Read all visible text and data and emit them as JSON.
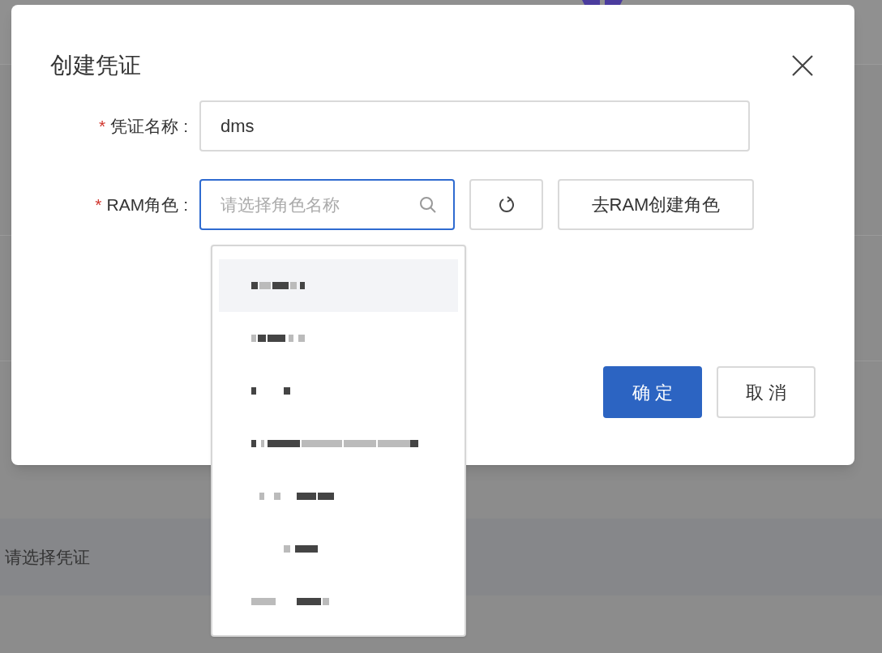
{
  "background": {
    "field_placeholder": "请选择凭证"
  },
  "dialog": {
    "title": "创建凭证",
    "fields": [
      {
        "kind": "text",
        "required_mark": "*",
        "label": "凭证名称",
        "label_suffix": ":",
        "value": "dms"
      },
      {
        "kind": "select",
        "required_mark": "*",
        "label": "RAM角色",
        "label_suffix": ":",
        "placeholder": "请选择角色名称",
        "focused": true
      }
    ],
    "role_buttons": [
      "去RAM创建角色"
    ],
    "buttons": [
      {
        "label": "确 定",
        "primary": true
      },
      {
        "label": "取 消",
        "primary": false
      }
    ]
  },
  "dropdown": {
    "options": [
      {
        "kind": "redacted",
        "highlighted": true
      },
      {
        "kind": "redacted",
        "highlighted": false
      },
      {
        "kind": "redacted",
        "highlighted": false
      },
      {
        "kind": "redacted",
        "highlighted": false
      },
      {
        "kind": "redacted",
        "highlighted": false
      },
      {
        "kind": "redacted",
        "highlighted": false
      },
      {
        "kind": "redacted",
        "highlighted": false
      }
    ]
  }
}
